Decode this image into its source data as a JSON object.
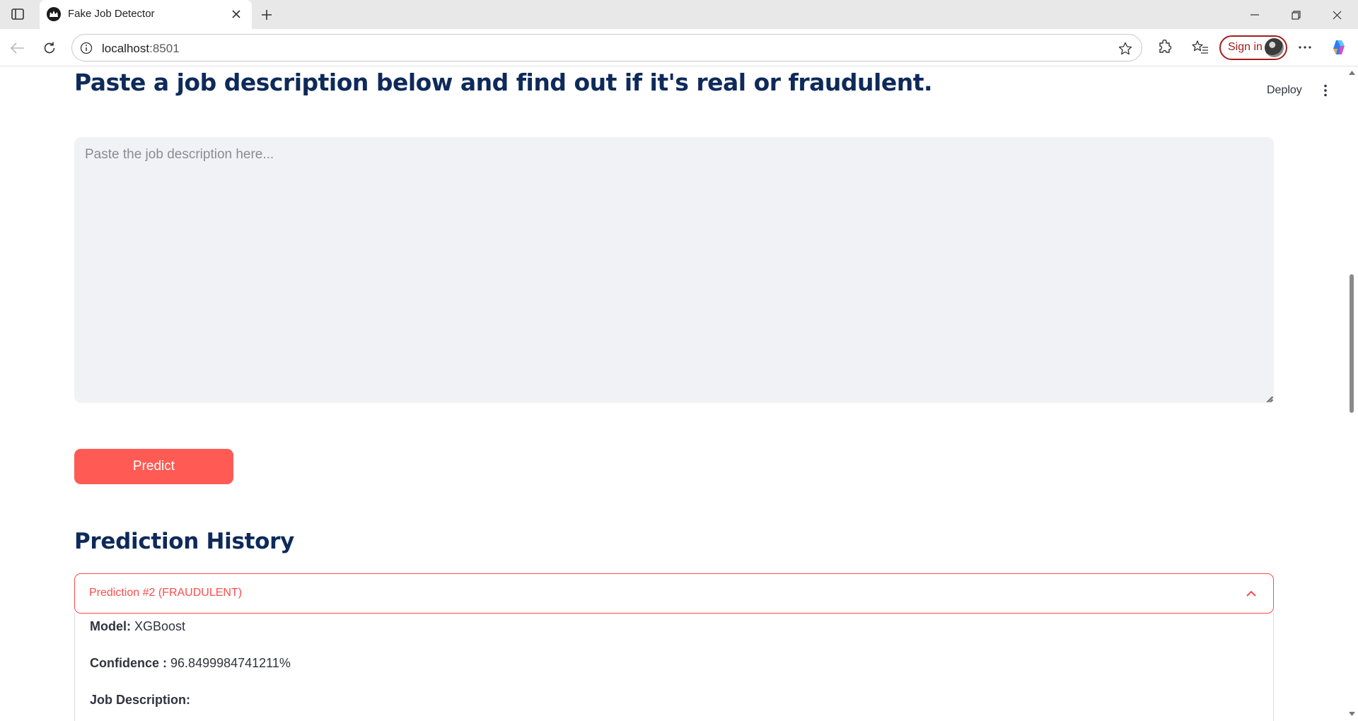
{
  "browser": {
    "tab_title": "Fake Job Detector",
    "url_host": "localhost",
    "url_port": ":8501",
    "signin_label": "Sign in"
  },
  "app": {
    "deploy_label": "Deploy",
    "headline": "Paste a job description below and find out if it's real or fraudulent.",
    "textarea_placeholder": "Paste the job description here...",
    "textarea_value": "",
    "predict_label": "Predict",
    "history_title": "Prediction History"
  },
  "history": {
    "items": [
      {
        "header": "Prediction #2 (FRAUDULENT)",
        "model_label": "Model:",
        "model_value": "XGBoost",
        "confidence_label": "Confidence :",
        "confidence_value": "96.8499984741211%",
        "job_description_label": "Job Description:"
      }
    ]
  },
  "colors": {
    "accent": "#ff4b4b",
    "button": "#ff5b54",
    "heading": "#0e2a5a",
    "input_bg": "#f0f2f6"
  },
  "icons": [
    "sidebar-toggle-icon",
    "app-favicon-icon",
    "close-icon",
    "plus-icon",
    "minimize-icon",
    "restore-icon",
    "back-icon",
    "reload-icon",
    "info-icon",
    "star-icon",
    "extensions-icon",
    "favorites-icon",
    "more-icon",
    "copilot-icon",
    "kebab-menu-icon",
    "chevron-up-icon"
  ]
}
